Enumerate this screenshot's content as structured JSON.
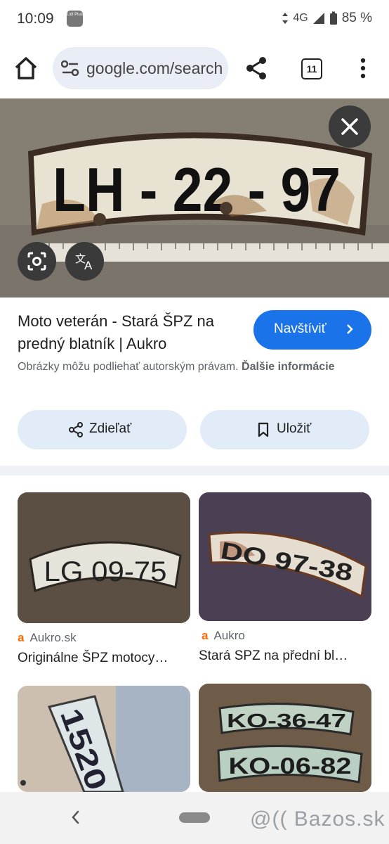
{
  "status_bar": {
    "time": "10:09",
    "lidl_badge": "Lidl Plus",
    "network": "4G",
    "battery": "85 %"
  },
  "browser": {
    "url": "google.com/search",
    "tab_count": "11"
  },
  "result": {
    "plate_text": "LH - 22 - 97",
    "title": "Moto veterán - Stará ŠPZ na predný blatník | Aukro",
    "visit_label": "Navštíviť",
    "copyright_notice": "Obrázky môžu podliehať autorským právam.",
    "more_info_link": "Ďalšie informácie",
    "share_label": "Zdieľať",
    "save_label": "Uložiť"
  },
  "related": [
    {
      "plate": "LG 09-75",
      "source": "Aukro.sk",
      "caption": "Originálne ŠPZ motocy…"
    },
    {
      "plate": "DO 97-38",
      "source": "Aukro",
      "caption": "Stará SPZ na přední bl…"
    },
    {
      "plate": "1520",
      "source": "",
      "caption": ""
    },
    {
      "plate": "KO-36-47",
      "plate2": "KO-06-82",
      "source": "",
      "caption": ""
    }
  ],
  "watermark": "Bazos.sk",
  "colors": {
    "accent": "#1a73e8",
    "pill_bg": "#e2ebf8",
    "favicon": "#ff6a00"
  }
}
